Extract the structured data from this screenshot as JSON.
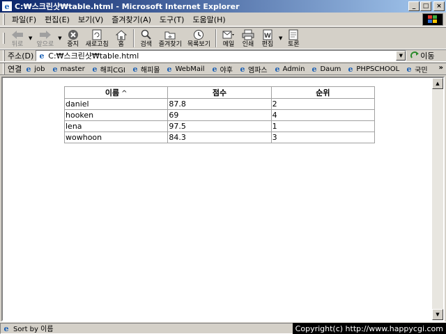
{
  "window": {
    "title": "C:₩스크린샷₩table.html - Microsoft Internet Explorer",
    "minimize": "_",
    "maximize": "□",
    "close": "×"
  },
  "menu": [
    "파일(F)",
    "편집(E)",
    "보기(V)",
    "즐겨찾기(A)",
    "도구(T)",
    "도움말(H)"
  ],
  "toolbar": {
    "back": "뒤로",
    "forward": "앞으로",
    "stop": "중지",
    "refresh": "새로고침",
    "home": "홈",
    "search": "검색",
    "favorites": "즐겨찾기",
    "history": "목록보기",
    "mail": "메일",
    "print": "인쇄",
    "edit": "편집",
    "discuss": "토론"
  },
  "address": {
    "label": "주소(D)",
    "value": "C:₩스크린샷₩table.html",
    "go": "이동"
  },
  "links": {
    "label": "연결",
    "items": [
      "job",
      "master",
      "해피CGI",
      "해피몰",
      "WebMail",
      "야후",
      "엠파스",
      "Admin",
      "Daum",
      "PHPSCHOOL",
      "국민"
    ]
  },
  "table": {
    "headers": [
      "이름",
      "점수",
      "순위"
    ],
    "sort_indicator": "^",
    "rows": [
      [
        "daniel",
        "87.8",
        "2"
      ],
      [
        "hooken",
        "69",
        "4"
      ],
      [
        "lena",
        "97.5",
        "1"
      ],
      [
        "wowhoon",
        "84.3",
        "3"
      ]
    ]
  },
  "status": {
    "text": "Sort by 이름",
    "copyright": "Copyright(c) http://www.happycgi.com"
  },
  "colors": {
    "titlebar_start": "#0a246a",
    "titlebar_end": "#a6caf0",
    "chrome": "#d4d0c8"
  }
}
